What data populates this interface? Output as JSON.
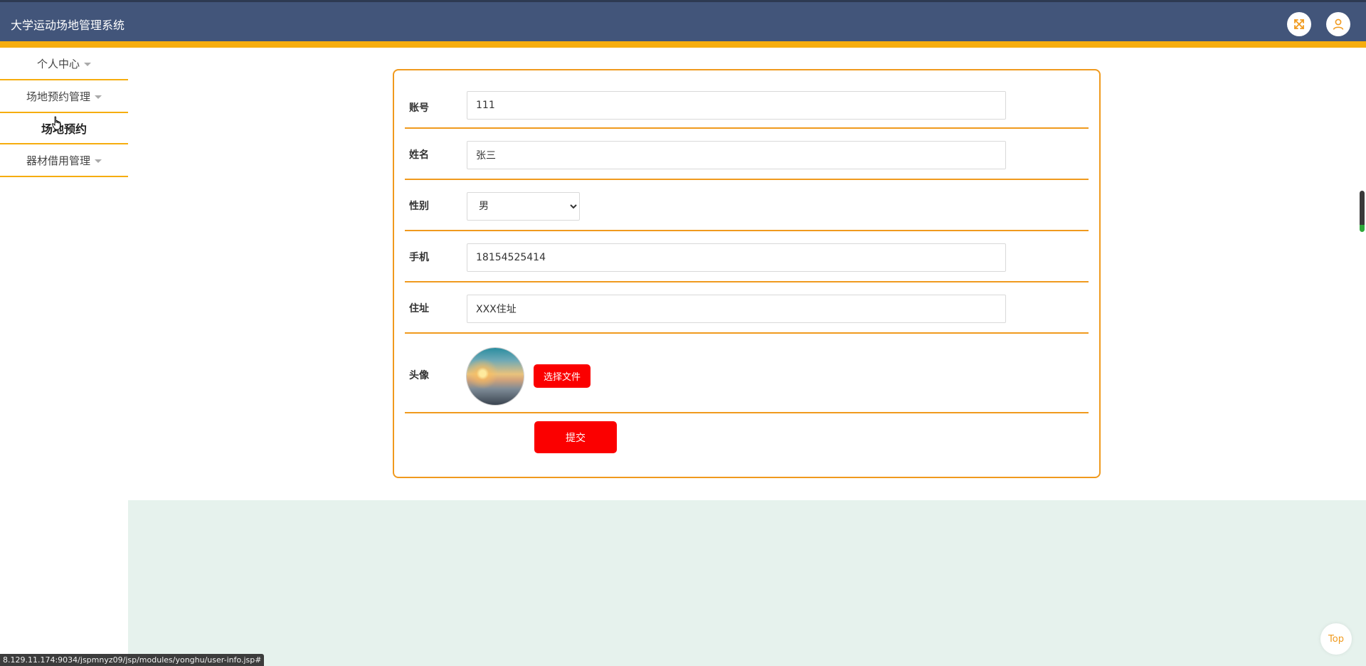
{
  "header": {
    "app_title": "大学运动场地管理系统",
    "fullscreen_icon": "expand-arrows-icon",
    "user_icon": "user-icon",
    "accent_color": "#f6ad0e",
    "bar_color": "#42557a"
  },
  "sidebar": {
    "items": [
      {
        "label": "个人中心",
        "has_caret": true
      },
      {
        "label": "场地预约管理",
        "has_caret": true
      },
      {
        "label": "场地预约",
        "is_sub": true
      },
      {
        "label": "器材借用管理",
        "has_caret": true
      }
    ]
  },
  "form": {
    "account": {
      "label": "账号",
      "value": "111"
    },
    "name": {
      "label": "姓名",
      "value": "张三"
    },
    "gender": {
      "label": "性别",
      "value": "男",
      "options": [
        "男"
      ]
    },
    "phone": {
      "label": "手机",
      "value": "18154525414"
    },
    "address": {
      "label": "住址",
      "value": "XXX住址"
    },
    "avatar": {
      "label": "头像",
      "choose_file_label": "选择文件"
    },
    "submit_label": "提交",
    "border_color": "#f09a1e",
    "button_color": "#fb0000"
  },
  "top_button": {
    "label": "Top"
  },
  "status_bar": {
    "url": "8.129.11.174:9034/jspmnyz09/jsp/modules/yonghu/user-info.jsp#"
  }
}
